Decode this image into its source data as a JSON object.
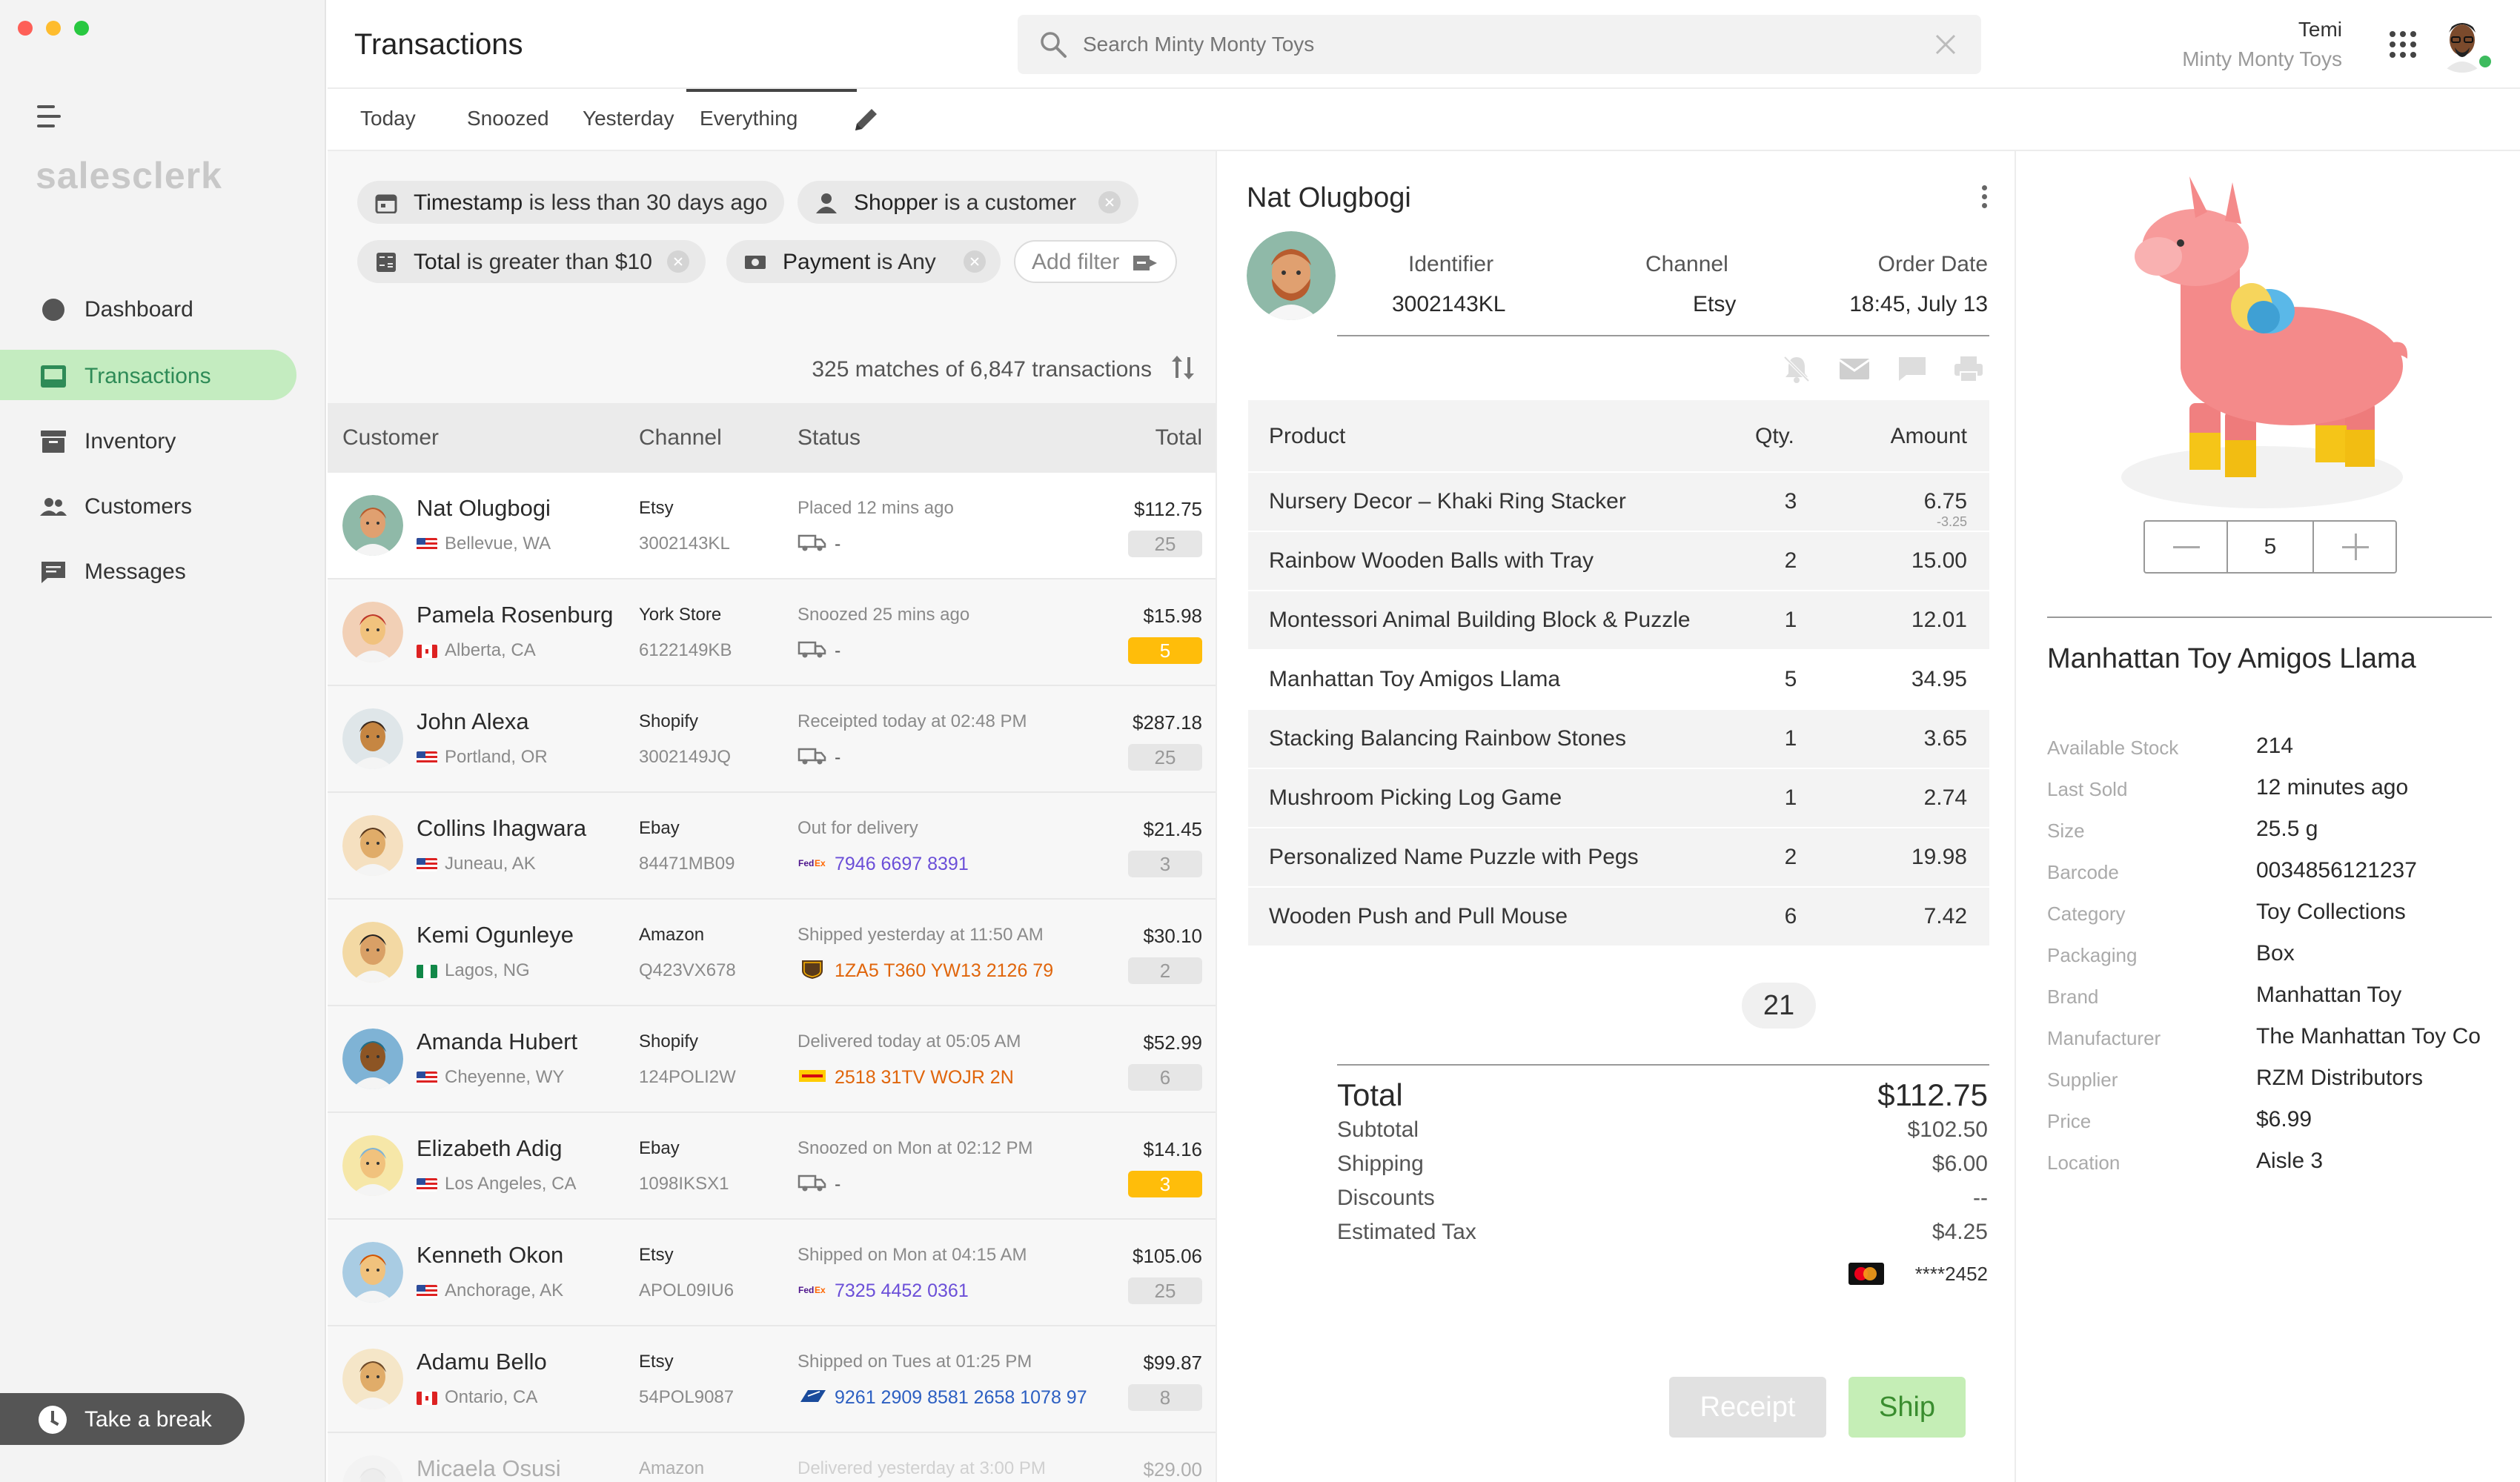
{
  "app": {
    "logo": "salesclerk"
  },
  "colors": {
    "accent": "#2e8b57",
    "active_nav_bg": "#c4ecc0",
    "warning": "#ffbd0a",
    "tracking_purple": "#6b4fd8",
    "tracking_orange": "#e0650b",
    "tracking_blue": "#2c5fc2"
  },
  "sidebar": {
    "items": [
      {
        "label": "Dashboard",
        "icon": "dashboard-icon"
      },
      {
        "label": "Transactions",
        "icon": "transactions-icon",
        "active": true
      },
      {
        "label": "Inventory",
        "icon": "inventory-icon"
      },
      {
        "label": "Customers",
        "icon": "customers-icon"
      },
      {
        "label": "Messages",
        "icon": "messages-icon"
      }
    ],
    "break_button": "Take a break"
  },
  "header": {
    "title": "Transactions",
    "search_placeholder": "Search Minty Monty Toys",
    "user_name": "Temi",
    "store_name": "Minty Monty Toys"
  },
  "tabs": [
    {
      "label": "Today"
    },
    {
      "label": "Snoozed"
    },
    {
      "label": "Yesterday"
    },
    {
      "label": "Everything",
      "active": true
    }
  ],
  "filters": [
    {
      "field": "Timestamp",
      "rest": "is less than 30 days ago",
      "icon": "calendar-icon"
    },
    {
      "field": "Shopper",
      "rest": "is a customer",
      "icon": "person-icon"
    },
    {
      "field": "Total",
      "rest": "is greater than $10",
      "icon": "calculator-icon"
    },
    {
      "field": "Payment",
      "rest": "is Any",
      "icon": "payment-icon"
    }
  ],
  "add_filter_label": "Add filter",
  "matches_text": "325 matches of 6,847 transactions",
  "list_columns": {
    "customer": "Customer",
    "channel": "Channel",
    "status": "Status",
    "total": "Total"
  },
  "transactions": [
    {
      "name": "Nat Olugbogi",
      "location": "Bellevue, WA",
      "country": "us",
      "channel": "Etsy",
      "order_id": "3002143KL",
      "status": "Placed 12 mins ago",
      "tracking": "-",
      "carrier": "truck",
      "total": "$112.75",
      "qty": "25",
      "qty_hot": false,
      "selected": true
    },
    {
      "name": "Pamela Rosenburg",
      "location": "Alberta, CA",
      "country": "ca",
      "channel": "York Store",
      "order_id": "6122149KB",
      "status": "Snoozed 25 mins ago",
      "tracking": "-",
      "carrier": "truck",
      "total": "$15.98",
      "qty": "5",
      "qty_hot": true
    },
    {
      "name": "John Alexa",
      "location": "Portland, OR",
      "country": "us",
      "channel": "Shopify",
      "order_id": "3002149JQ",
      "status": "Receipted today at 02:48 PM",
      "tracking": "-",
      "carrier": "truck",
      "total": "$287.18",
      "qty": "25",
      "qty_hot": false
    },
    {
      "name": "Collins Ihagwara",
      "location": "Juneau, AK",
      "country": "us",
      "channel": "Ebay",
      "order_id": "84471MB09",
      "status": "Out for delivery",
      "tracking": "7946 6697 8391",
      "carrier": "fedex",
      "total": "$21.45",
      "qty": "3",
      "qty_hot": false
    },
    {
      "name": "Kemi Ogunleye",
      "location": "Lagos, NG",
      "country": "ng",
      "channel": "Amazon",
      "order_id": "Q423VX678",
      "status": "Shipped yesterday at 11:50 AM",
      "tracking": "1ZA5 T360 YW13 2126 79",
      "carrier": "ups",
      "total": "$30.10",
      "qty": "2",
      "qty_hot": false
    },
    {
      "name": "Amanda Hubert",
      "location": "Cheyenne, WY",
      "country": "us",
      "channel": "Shopify",
      "order_id": "124POLI2W",
      "status": "Delivered today at 05:05 AM",
      "tracking": "2518 31TV WOJR 2N",
      "carrier": "dhl",
      "total": "$52.99",
      "qty": "6",
      "qty_hot": false
    },
    {
      "name": "Elizabeth Adig",
      "location": "Los Angeles, CA",
      "country": "us",
      "channel": "Ebay",
      "order_id": "1098IKSX1",
      "status": "Snoozed on Mon at 02:12 PM",
      "tracking": "-",
      "carrier": "truck",
      "total": "$14.16",
      "qty": "3",
      "qty_hot": true
    },
    {
      "name": "Kenneth Okon",
      "location": "Anchorage, AK",
      "country": "us",
      "channel": "Etsy",
      "order_id": "APOL09IU6",
      "status": "Shipped on Mon at 04:15 AM",
      "tracking": "7325 4452 0361",
      "carrier": "fedex",
      "total": "$105.06",
      "qty": "25",
      "qty_hot": false
    },
    {
      "name": "Adamu Bello",
      "location": "Ontario, CA",
      "country": "ca",
      "channel": "Etsy",
      "order_id": "54POL9087",
      "status": "Shipped on Tues at 01:25 PM",
      "tracking": "9261 2909 8581 2658 1078 97",
      "carrier": "usps",
      "total": "$99.87",
      "qty": "8",
      "qty_hot": false
    },
    {
      "name": "Micaela Osusi",
      "location": "",
      "country": "",
      "channel": "Amazon",
      "order_id": "",
      "status": "Delivered yesterday at 3:00 PM",
      "tracking": "",
      "carrier": "",
      "total": "$29.00",
      "qty": "",
      "qty_hot": false,
      "ghost": true
    }
  ],
  "order": {
    "customer": "Nat Olugbogi",
    "identifier_label": "Identifier",
    "identifier": "3002143KL",
    "channel_label": "Channel",
    "channel": "Etsy",
    "date_label": "Order Date",
    "date": "18:45, July 13",
    "columns": {
      "product": "Product",
      "qty": "Qty.",
      "amount": "Amount"
    },
    "items": [
      {
        "product": "Nursery Decor – Khaki Ring Stacker",
        "qty": "3",
        "amount": "6.75",
        "discount": "-3.25"
      },
      {
        "product": "Rainbow Wooden Balls with Tray",
        "qty": "2",
        "amount": "15.00"
      },
      {
        "product": "Montessori Animal Building Block & Puzzle",
        "qty": "1",
        "amount": "12.01"
      },
      {
        "product": "Manhattan Toy Amigos Llama",
        "qty": "5",
        "amount": "34.95",
        "selected": true
      },
      {
        "product": "Stacking Balancing Rainbow Stones",
        "qty": "1",
        "amount": "3.65"
      },
      {
        "product": "Mushroom Picking Log Game",
        "qty": "1",
        "amount": "2.74"
      },
      {
        "product": "Personalized Name Puzzle with Pegs",
        "qty": "2",
        "amount": "19.98"
      },
      {
        "product": "Wooden Push and Pull Mouse",
        "qty": "6",
        "amount": "7.42"
      }
    ],
    "total_qty": "21",
    "totals": {
      "total_label": "Total",
      "total": "$112.75",
      "subtotal_label": "Subtotal",
      "subtotal": "$102.50",
      "shipping_label": "Shipping",
      "shipping": "$6.00",
      "discounts_label": "Discounts",
      "discounts": "--",
      "tax_label": "Estimated Tax",
      "tax": "$4.25"
    },
    "card": "****2452",
    "receipt_button": "Receipt",
    "ship_button": "Ship"
  },
  "product": {
    "name": "Manhattan Toy Amigos Llama",
    "quantity": "5",
    "specs": [
      {
        "label": "Available Stock",
        "value": "214"
      },
      {
        "label": "Last Sold",
        "value": "12 minutes ago"
      },
      {
        "label": "Size",
        "value": "25.5 g"
      },
      {
        "label": "Barcode",
        "value": "0034856121237"
      },
      {
        "label": "Category",
        "value": "Toy Collections"
      },
      {
        "label": "Packaging",
        "value": "Box"
      },
      {
        "label": "Brand",
        "value": "Manhattan Toy"
      },
      {
        "label": "Manufacturer",
        "value": "The Manhattan Toy Co"
      },
      {
        "label": "Supplier",
        "value": "RZM Distributors"
      },
      {
        "label": "Price",
        "value": "$6.99"
      },
      {
        "label": "Location",
        "value": "Aisle 3"
      }
    ]
  }
}
